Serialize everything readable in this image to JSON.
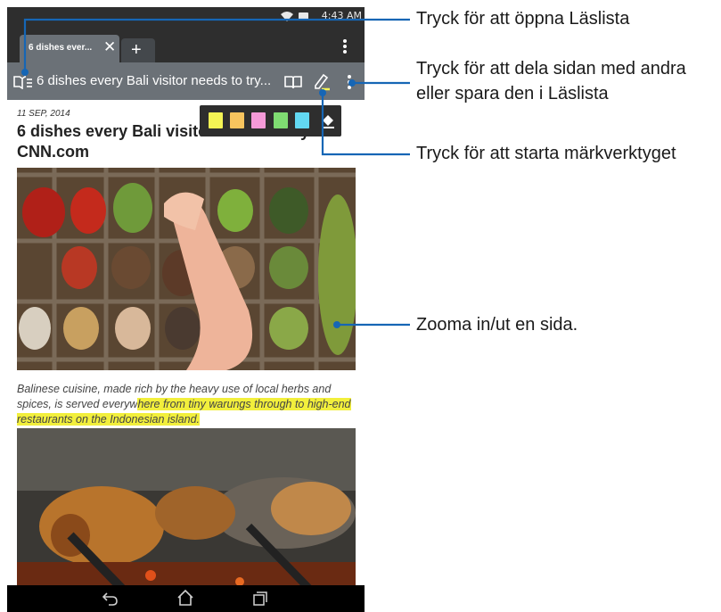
{
  "status_bar": {
    "time": "4:43 AM"
  },
  "tab_bar": {
    "active_tab_title": "6 dishes ever...",
    "close_label": "✕",
    "new_tab_label": "+"
  },
  "url_bar": {
    "page_title": "6 dishes every Bali visitor needs to try..."
  },
  "marker_palette": {
    "colors": [
      "#f4f454",
      "#f7c45e",
      "#f59ad8",
      "#7fdc72",
      "#62d8f2"
    ]
  },
  "article": {
    "date": "11 SEP, 2014",
    "title": "6 dishes every Bali visitor needs to try - CNN.com",
    "caption_plain": "Balinese cuisine, made rich by the heavy use of local herbs and spices, is served everyw",
    "caption_highlighted": "here from tiny warungs through to high-end restaurants on the Indonesian island."
  },
  "callouts": {
    "reading_list": "Tryck för att öppna Läslista",
    "share_line1": "Tryck för att dela sidan med andra",
    "share_line2": "eller spara den i Läslista",
    "marker_tool": "Tryck för att starta märkverktyget",
    "zoom": "Zooma in/ut en sida."
  },
  "colors": {
    "callout_line": "#1666b5",
    "highlight": "#f2ef3c",
    "toolbar": "#6b7177",
    "chrome": "#2e2e2e"
  }
}
